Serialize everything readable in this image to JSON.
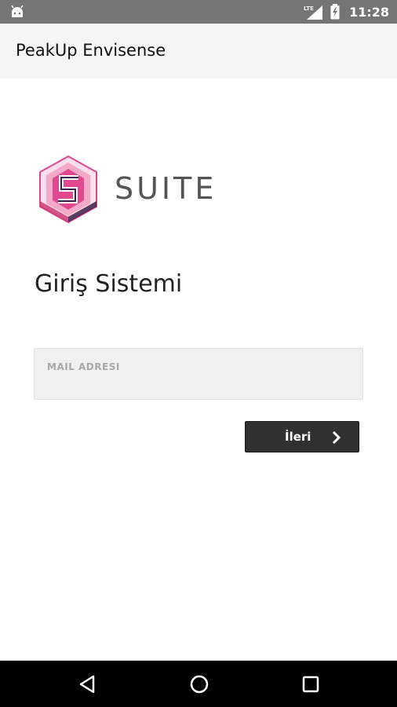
{
  "status_bar": {
    "network": "LTE",
    "time": "11:28",
    "icons": [
      "android-icon",
      "signal-icon",
      "battery-icon"
    ]
  },
  "app_bar": {
    "title": "PeakUp Envisense"
  },
  "logo": {
    "wordmark": "SUITE",
    "colors": [
      "#e2488f",
      "#3b1f4a",
      "#f3a9c8"
    ]
  },
  "login": {
    "heading": "Giriş Sistemi",
    "mail_label": "MAIL ADRESI",
    "mail_value": "",
    "next_label": "İleri"
  },
  "nav_bar": {
    "icons": [
      "back-icon",
      "home-icon",
      "recents-icon"
    ]
  },
  "colors": {
    "status_bar": "#757575",
    "app_bar": "#f5f5f5",
    "button": "#303030",
    "field": "#f0f0f0"
  }
}
